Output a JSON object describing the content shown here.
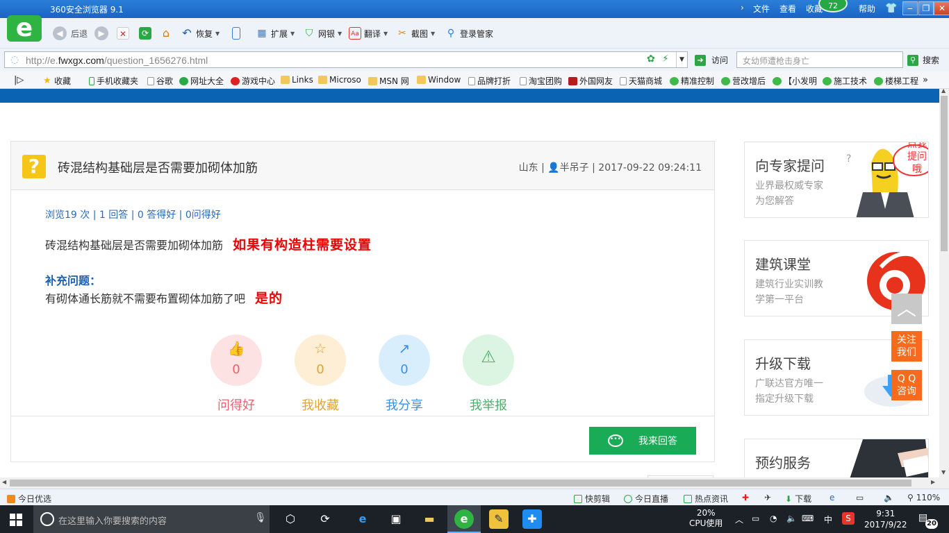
{
  "browser": {
    "title": "360安全浏览器 9.1",
    "menu": [
      "文件",
      "查看",
      "收藏",
      "帮助"
    ],
    "badge": "72",
    "toolbar": {
      "back": "后退",
      "restore": "恢复",
      "extensions": "扩展",
      "bank": "网银",
      "translate": "翻译",
      "screenshot": "截图",
      "login": "登录管家"
    },
    "url_prefix": "http://e.",
    "url_domain": "fwxgx.com",
    "url_path": "/question_1656276.html",
    "visit": "访问",
    "search_placeholder": "女幼师遭枪击身亡",
    "search_btn": "搜索",
    "favorites": [
      "收藏",
      "手机收藏夹",
      "谷歌",
      "网址大全",
      "游戏中心",
      "Links",
      "Microso",
      "MSN 网",
      "Window",
      "品牌打折",
      "淘宝团购",
      "外国网友",
      "天猫商城",
      "精准控制",
      "营改增后",
      "【小发明",
      "施工技术",
      "楼梯工程"
    ]
  },
  "question": {
    "icon": "?",
    "title": "砖混结构基础层是否需要加砌体加筋",
    "location": "山东",
    "user": "半吊子",
    "datetime": "2017-09-22 09:24:11",
    "stats": "浏览19 次 | 1 回答 | 0 答得好 | 0问得好",
    "body": "砖混结构基础层是否需要加砌体加筋",
    "body_annotation": "如果有构造柱需要设置",
    "supplement_title": "补充问题：",
    "supplement_text": "有砌体通长筋就不需要布置砌体加筋了吧",
    "supplement_annotation": "是的",
    "actions": [
      {
        "label": "问得好",
        "count": "0",
        "color": "#e9616d",
        "bg": "#fde2e4"
      },
      {
        "label": "我收藏",
        "count": "0",
        "color": "#e0a33c",
        "bg": "#fdeed5"
      },
      {
        "label": "我分享",
        "count": "0",
        "color": "#3c8fe0",
        "bg": "#d9eefd"
      },
      {
        "label": "我举报",
        "count": "",
        "color": "#4caf6a",
        "bg": "#dcf5e2"
      }
    ],
    "answer_btn": "我来回答"
  },
  "sidebar": [
    {
      "title": "向专家提问",
      "sub1": "业界最权威专家",
      "sub2": "为您解答",
      "bubble1": "点我",
      "bubble2": "提问哦"
    },
    {
      "title": "建筑课堂",
      "sub1": "建筑行业实训教",
      "sub2": "学第一平台"
    },
    {
      "title": "升级下载",
      "sub1": "广联达官方唯一",
      "sub2": "指定升级下载"
    },
    {
      "title": "预约服务"
    }
  ],
  "float": {
    "follow": "关注我们",
    "follow1": "关注",
    "follow2": "我们",
    "qq1": "Q Q",
    "qq2": "咨询"
  },
  "statusbar": {
    "today": "今日优选",
    "items": [
      "快剪辑",
      "今日直播",
      "热点资讯",
      "下载"
    ],
    "zoom": "110%"
  },
  "taskbar": {
    "search_placeholder": "在这里输入你要搜索的内容",
    "cpu": "20%",
    "cpu_label": "CPU使用",
    "ime": "中",
    "time": "9:31",
    "date": "2017/9/22",
    "notifications": "20"
  },
  "colors": {
    "accent_blue": "#0b63b4",
    "answer_green": "#1aab57",
    "annotation_red": "#e00000",
    "float_orange": "#f76b1c"
  }
}
